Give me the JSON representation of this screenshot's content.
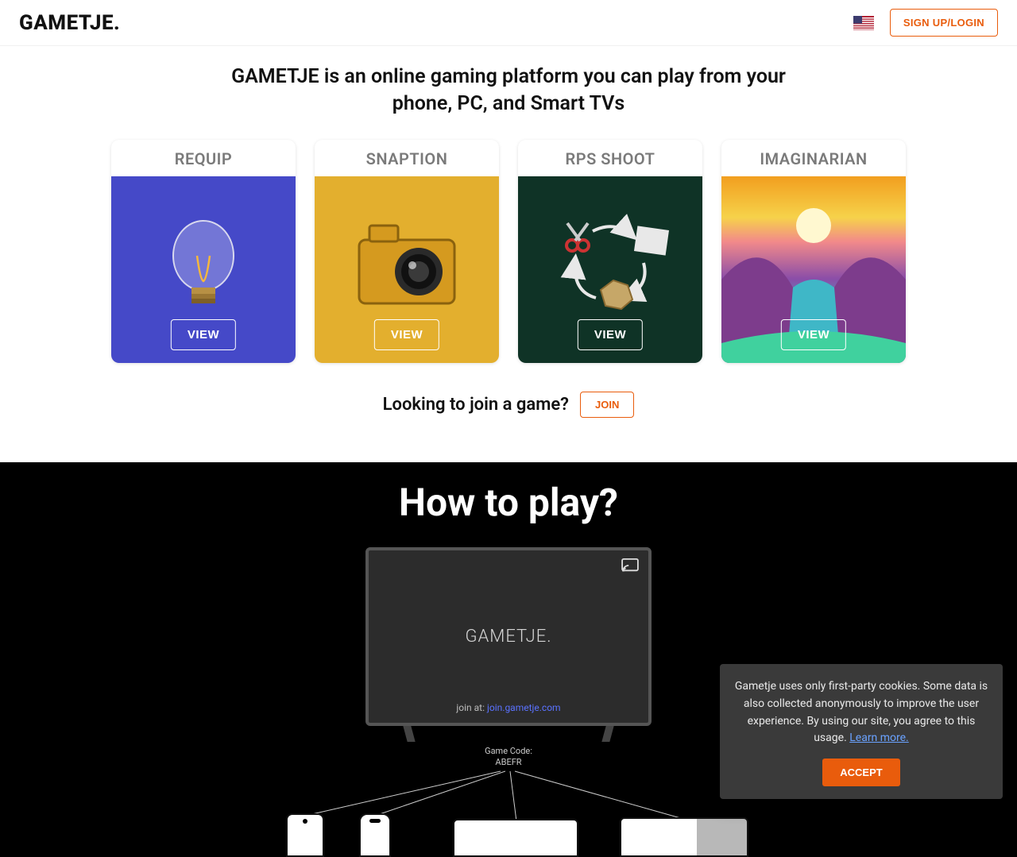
{
  "header": {
    "logo": "GAMETJE.",
    "signup_label": "SIGN UP/LOGIN",
    "flag_name": "us-flag-icon"
  },
  "hero": {
    "tagline": "GAMETJE is an online gaming platform you can play from your phone, PC, and Smart TVs"
  },
  "games": [
    {
      "title": "REQUIP",
      "view_label": "VIEW",
      "bg": "bg-requip",
      "icon": "lightbulb-icon"
    },
    {
      "title": "SNAPTION",
      "view_label": "VIEW",
      "bg": "bg-snaption",
      "icon": "camera-icon"
    },
    {
      "title": "RPS SHOOT",
      "view_label": "VIEW",
      "bg": "bg-rps",
      "icon": "rps-cycle-icon"
    },
    {
      "title": "IMAGINARIAN",
      "view_label": "VIEW",
      "bg": "bg-imaginarian",
      "icon": "landscape-art-icon"
    }
  ],
  "join": {
    "prompt": "Looking to join a game?",
    "button": "JOIN"
  },
  "howto": {
    "heading": "How to play?",
    "tv_brand": "GAMETJE.",
    "tv_join_prefix": "join at:",
    "tv_join_link": "join.gametje.com",
    "game_code_label": "Game Code:",
    "game_code_value": "ABEFR"
  },
  "cookie": {
    "text": "Gametje uses only first-party cookies. Some data is also collected anonymously to improve the user experience. By using our site, you agree to this usage. ",
    "learn_more": "Learn more.",
    "accept": "ACCEPT"
  },
  "colors": {
    "accent": "#e95c0c"
  }
}
